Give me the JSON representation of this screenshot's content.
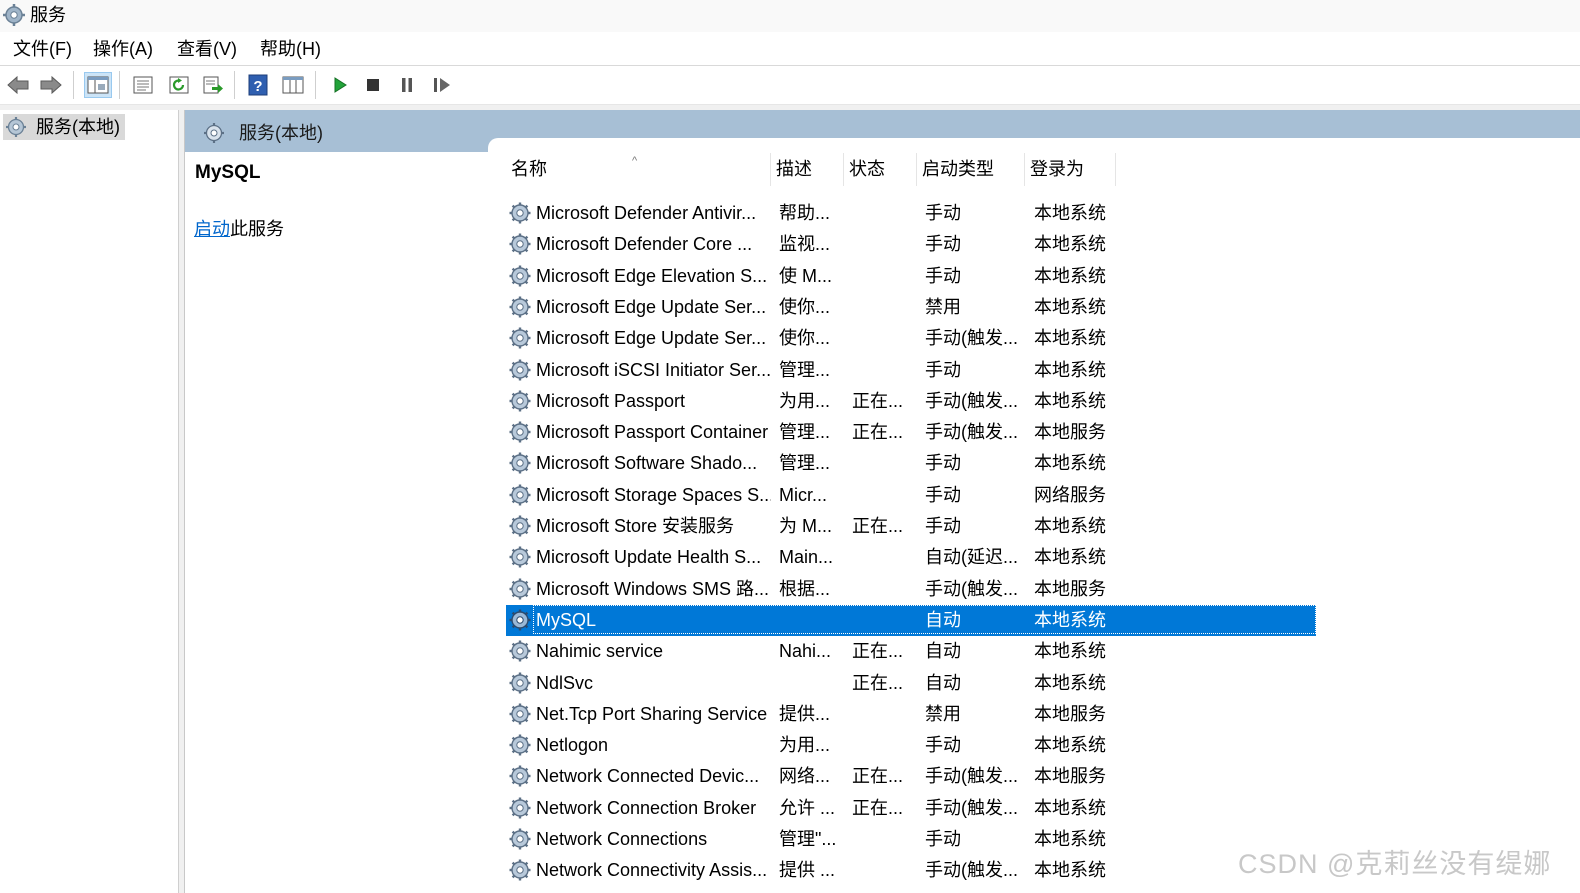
{
  "title": "服务",
  "menu": [
    "文件(F)",
    "操作(A)",
    "查看(V)",
    "帮助(H)"
  ],
  "toolbar": {
    "buttons": [
      "back-icon",
      "forward-icon",
      "console-tree-icon",
      "properties-icon",
      "refresh-icon",
      "export-list-icon",
      "help-icon",
      "mmc-view-icon",
      "start-service-icon",
      "stop-service-icon",
      "pause-service-icon",
      "restart-service-icon"
    ]
  },
  "tree": {
    "root_label": "服务(本地)"
  },
  "panel": {
    "header": "服务(本地)",
    "selected_service": "MySQL",
    "start_link": "启动",
    "start_suffix": "此服务"
  },
  "columns": {
    "name": "名称",
    "description": "描述",
    "status": "状态",
    "startup_type": "启动类型",
    "logon_as": "登录为"
  },
  "services": [
    {
      "name": "Microsoft Defender Antivir...",
      "description": "帮助...",
      "status": "",
      "startup": "手动",
      "logon": "本地系统"
    },
    {
      "name": "Microsoft Defender Core ...",
      "description": "监视...",
      "status": "",
      "startup": "手动",
      "logon": "本地系统"
    },
    {
      "name": "Microsoft Edge Elevation S...",
      "description": "使 M...",
      "status": "",
      "startup": "手动",
      "logon": "本地系统"
    },
    {
      "name": "Microsoft Edge Update Ser...",
      "description": "使你...",
      "status": "",
      "startup": "禁用",
      "logon": "本地系统"
    },
    {
      "name": "Microsoft Edge Update Ser...",
      "description": "使你...",
      "status": "",
      "startup": "手动(触发...",
      "logon": "本地系统"
    },
    {
      "name": "Microsoft iSCSI Initiator Ser...",
      "description": "管理...",
      "status": "",
      "startup": "手动",
      "logon": "本地系统"
    },
    {
      "name": "Microsoft Passport",
      "description": "为用...",
      "status": "正在...",
      "startup": "手动(触发...",
      "logon": "本地系统"
    },
    {
      "name": "Microsoft Passport Container",
      "description": "管理...",
      "status": "正在...",
      "startup": "手动(触发...",
      "logon": "本地服务"
    },
    {
      "name": "Microsoft Software Shado...",
      "description": "管理...",
      "status": "",
      "startup": "手动",
      "logon": "本地系统"
    },
    {
      "name": "Microsoft Storage Spaces S...",
      "description": "Micr...",
      "status": "",
      "startup": "手动",
      "logon": "网络服务"
    },
    {
      "name": "Microsoft Store 安装服务",
      "description": "为 M...",
      "status": "正在...",
      "startup": "手动",
      "logon": "本地系统"
    },
    {
      "name": "Microsoft Update Health S...",
      "description": "Main...",
      "status": "",
      "startup": "自动(延迟...",
      "logon": "本地系统"
    },
    {
      "name": "Microsoft Windows SMS 路...",
      "description": "根据...",
      "status": "",
      "startup": "手动(触发...",
      "logon": "本地服务"
    },
    {
      "name": "MySQL",
      "description": "",
      "status": "",
      "startup": "自动",
      "logon": "本地系统",
      "selected": true
    },
    {
      "name": "Nahimic service",
      "description": "Nahi...",
      "status": "正在...",
      "startup": "自动",
      "logon": "本地系统"
    },
    {
      "name": "NdlSvc",
      "description": "",
      "status": "正在...",
      "startup": "自动",
      "logon": "本地系统"
    },
    {
      "name": "Net.Tcp Port Sharing Service",
      "description": "提供...",
      "status": "",
      "startup": "禁用",
      "logon": "本地服务"
    },
    {
      "name": "Netlogon",
      "description": "为用...",
      "status": "",
      "startup": "手动",
      "logon": "本地系统"
    },
    {
      "name": "Network Connected Devic...",
      "description": "网络...",
      "status": "正在...",
      "startup": "手动(触发...",
      "logon": "本地服务"
    },
    {
      "name": "Network Connection Broker",
      "description": "允许 ...",
      "status": "正在...",
      "startup": "手动(触发...",
      "logon": "本地系统"
    },
    {
      "name": "Network Connections",
      "description": "管理\"...",
      "status": "",
      "startup": "手动",
      "logon": "本地系统"
    },
    {
      "name": "Network Connectivity Assis...",
      "description": "提供 ...",
      "status": "",
      "startup": "手动(触发...",
      "logon": "本地系统"
    }
  ],
  "watermark": "CSDN @克莉丝没有缇娜"
}
